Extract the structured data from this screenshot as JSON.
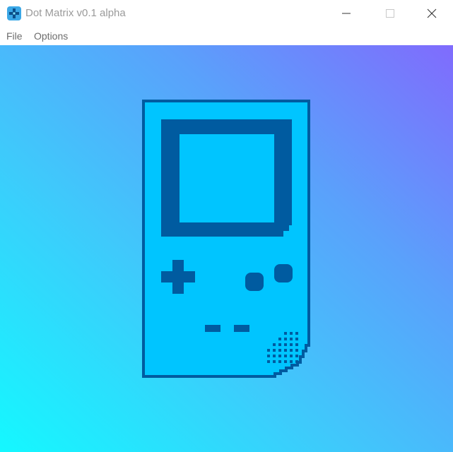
{
  "window": {
    "title": "Dot Matrix v0.1 alpha",
    "app_icon": "dpad-app-icon",
    "controls": [
      "minimize-icon",
      "maximize-icon",
      "close-icon"
    ]
  },
  "menubar": {
    "items": [
      {
        "label": "File"
      },
      {
        "label": "Options"
      }
    ]
  },
  "content": {
    "illustration": "handheld-console-icon",
    "colors": {
      "gradient_bottom_left": "#14f8ff",
      "gradient_top_right": "#806bfd",
      "console_body": "#00c5ff",
      "console_outline": "#005ba0"
    }
  }
}
